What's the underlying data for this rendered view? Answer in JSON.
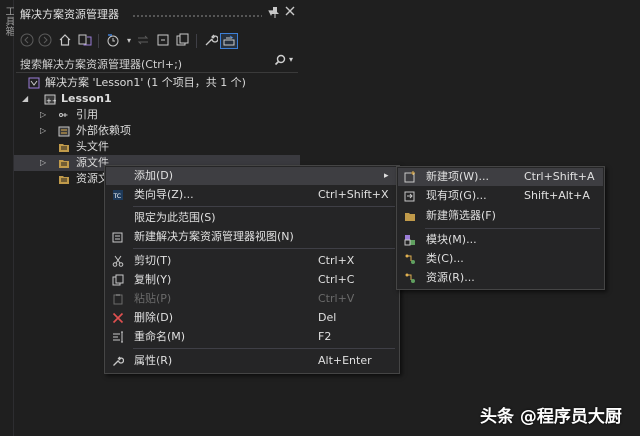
{
  "side_strip": {
    "label": "工具箱"
  },
  "panel": {
    "title": "解决方案资源管理器",
    "pin_glyph": "▾",
    "search_placeholder": "搜索解决方案资源管理器(Ctrl+;)"
  },
  "tree": {
    "solution": "解决方案 'Lesson1' (1 个项目，共 1 个)",
    "project": "Lesson1",
    "references": "引用",
    "external_deps": "外部依赖项",
    "header_files": "头文件",
    "source_files": "源文件",
    "resource_files": "资源文"
  },
  "context_menu": {
    "items": [
      {
        "label": "添加(D)",
        "shortcut": "▸"
      },
      {
        "label": "类向导(Z)...",
        "shortcut": "Ctrl+Shift+X"
      },
      {
        "label": "限定为此范围(S)",
        "shortcut": ""
      },
      {
        "label": "新建解决方案资源管理器视图(N)",
        "shortcut": ""
      },
      {
        "label": "剪切(T)",
        "shortcut": "Ctrl+X"
      },
      {
        "label": "复制(Y)",
        "shortcut": "Ctrl+C"
      },
      {
        "label": "粘贴(P)",
        "shortcut": "Ctrl+V"
      },
      {
        "label": "删除(D)",
        "shortcut": "Del"
      },
      {
        "label": "重命名(M)",
        "shortcut": "F2"
      },
      {
        "label": "属性(R)",
        "shortcut": "Alt+Enter"
      }
    ]
  },
  "submenu": {
    "items": [
      {
        "label": "新建项(W)...",
        "shortcut": "Ctrl+Shift+A"
      },
      {
        "label": "现有项(G)...",
        "shortcut": "Shift+Alt+A"
      },
      {
        "label": "新建筛选器(F)",
        "shortcut": ""
      },
      {
        "label": "模块(M)...",
        "shortcut": ""
      },
      {
        "label": "类(C)...",
        "shortcut": ""
      },
      {
        "label": "资源(R)...",
        "shortcut": ""
      }
    ]
  },
  "watermark": "头条 @程序员大厨",
  "colors": {
    "accent": "#3d7fd6",
    "menu_bg": "#252526",
    "panel_bg": "#1f1f1f",
    "selection": "#3a3a3f"
  }
}
